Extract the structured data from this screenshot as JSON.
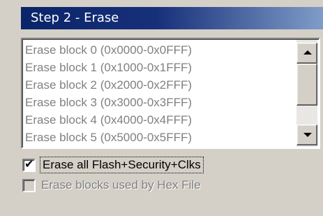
{
  "title": "Step 2 - Erase",
  "erase_blocks": [
    "Erase block 0 (0x0000-0x0FFF)",
    "Erase block 1 (0x1000-0x1FFF)",
    "Erase block 2 (0x2000-0x2FFF)",
    "Erase block 3 (0x3000-0x3FFF)",
    "Erase block 4 (0x4000-0x4FFF)",
    "Erase block 5 (0x5000-0x5FFF)"
  ],
  "options": {
    "erase_all": {
      "label": "Erase all Flash+Security+Clks",
      "checked": true,
      "mark": "✔"
    },
    "erase_hex": {
      "label": "Erase blocks used by Hex File",
      "checked": false,
      "enabled": false
    }
  },
  "scrollbar": {
    "up_icon": "arrow-up-icon",
    "down_icon": "arrow-down-icon"
  }
}
